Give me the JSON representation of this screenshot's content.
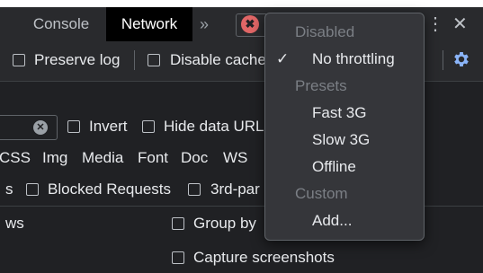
{
  "tabs": [
    {
      "label": "Console"
    },
    {
      "label": "Network"
    }
  ],
  "overflow_glyph": "»",
  "error_badge": "✖",
  "toolbar": {
    "preserve_log": "Preserve log",
    "disable_cache": "Disable cache"
  },
  "filter": {
    "invert": "Invert",
    "hide_data_urls": "Hide data URL"
  },
  "types": [
    "CSS",
    "Img",
    "Media",
    "Font",
    "Doc",
    "WS"
  ],
  "row_blocked": {
    "prefix": "s",
    "blocked_requests": "Blocked Requests",
    "third_party": "3rd-par"
  },
  "settings": {
    "rows_partial": "ws",
    "group_by": "Group by",
    "capture_screenshots": "Capture screenshots"
  },
  "throttling_menu": {
    "checkmark": "✓",
    "items": [
      {
        "type": "header",
        "label": "Disabled"
      },
      {
        "type": "option",
        "label": "No throttling",
        "checked": true
      },
      {
        "type": "header",
        "label": "Presets"
      },
      {
        "type": "option",
        "label": "Fast 3G"
      },
      {
        "type": "option",
        "label": "Slow 3G"
      },
      {
        "type": "option",
        "label": "Offline"
      },
      {
        "type": "header",
        "label": "Custom"
      },
      {
        "type": "option",
        "label": "Add..."
      }
    ]
  },
  "colors": {
    "accent": "#8ab4f8",
    "error": "#e06666",
    "menu_bg": "#35363a",
    "panel_bg": "#202124"
  }
}
